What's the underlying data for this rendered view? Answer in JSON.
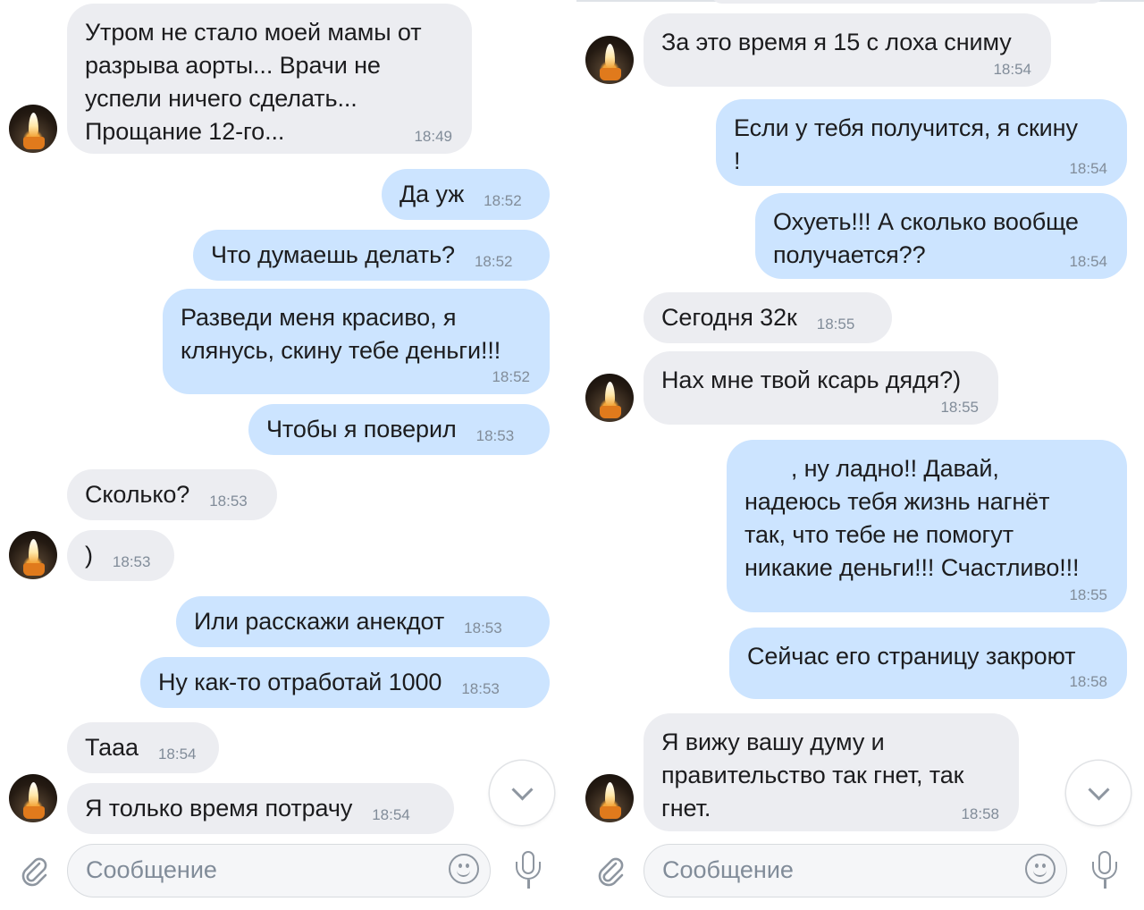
{
  "left_panel": {
    "messages": [
      {
        "text": "Утром не стало моей мамы от\nразрыва аорты... Врачи не\nуспели ничего сделать...\nПрощание 12-го...",
        "time": "18:49"
      },
      {
        "text": "Да уж",
        "time": "18:52"
      },
      {
        "text": "Что думаешь делать?",
        "time": "18:52"
      },
      {
        "text": "Разведи меня красиво, я\nклянусь, скину тебе деньги!!!",
        "time": "18:52"
      },
      {
        "text": "Чтобы я поверил",
        "time": "18:53"
      },
      {
        "text": "Сколько?",
        "time": "18:53"
      },
      {
        "text": ")",
        "time": "18:53"
      },
      {
        "text": "Или расскажи анекдот",
        "time": "18:53"
      },
      {
        "text": "Ну как-то отработай 1000",
        "time": "18:53"
      },
      {
        "text": "Тааа",
        "time": "18:54"
      },
      {
        "text": "Я только время потрачу",
        "time": "18:54"
      }
    ],
    "composer": {
      "placeholder": "Сообщение"
    }
  },
  "right_panel": {
    "messages": [
      {
        "text": "За это время я 15 с лоха сниму",
        "time": "18:54"
      },
      {
        "text": "Если у тебя получится, я скину\n!",
        "time": "18:54"
      },
      {
        "text": "Охуеть!!! А сколько вообще\nполучается??",
        "time": "18:54"
      },
      {
        "text": "Сегодня 32к",
        "time": "18:55"
      },
      {
        "text": "Нах мне твой ксарь дядя?)",
        "time": "18:55"
      },
      {
        "text": "       , ну ладно!! Давай,\nнадеюсь тебя жизнь нагнёт\nтак, что тебе не помогут\nникакие деньги!!! Счастливо!!!",
        "time": "18:55"
      },
      {
        "text": "Сейчас его страницу закроют",
        "time": "18:58"
      },
      {
        "text": "Я вижу вашу думу и\nправительство так гнет, так\nгнет.",
        "time": "18:58"
      }
    ],
    "composer": {
      "placeholder": "Сообщение"
    }
  },
  "icons": {
    "avatar": "candle-avatar-icon",
    "scroll": "chevron-down-icon",
    "attach": "paperclip-icon",
    "emoji": "smile-icon",
    "voice": "microphone-icon"
  },
  "colors": {
    "incoming_bubble": "#ecedf1",
    "outgoing_bubble": "#cce4ff",
    "time_text": "#818c99"
  }
}
